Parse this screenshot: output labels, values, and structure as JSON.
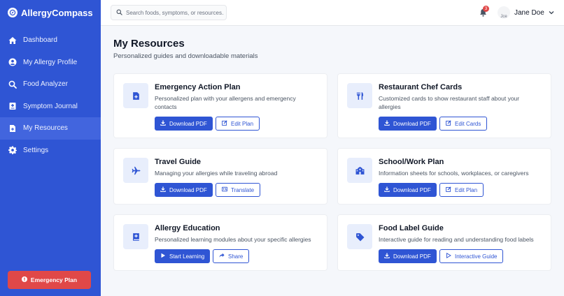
{
  "app": {
    "name": "AllergyCompass"
  },
  "sidebar": {
    "items": [
      {
        "label": "Dashboard",
        "icon": "home-icon"
      },
      {
        "label": "My Allergy Profile",
        "icon": "user-circle-icon"
      },
      {
        "label": "Food Analyzer",
        "icon": "search-icon"
      },
      {
        "label": "Symptom Journal",
        "icon": "journal-icon"
      },
      {
        "label": "My Resources",
        "icon": "file-icon",
        "active": true
      },
      {
        "label": "Settings",
        "icon": "gear-icon"
      }
    ],
    "emergency_label": "Emergency Plan"
  },
  "header": {
    "search_placeholder": "Search foods, symptoms, or resources...",
    "notification_count": "3",
    "user_name": "Jane Doe",
    "avatar_alt": "Jce"
  },
  "main": {
    "title": "My Resources",
    "subtitle": "Personalized guides and downloadable materials",
    "cards": [
      {
        "title": "Emergency Action Plan",
        "description": "Personalized plan with your allergens and emergency contacts",
        "icon": "medical-file-icon",
        "primary": "Download PDF",
        "secondary": "Edit Plan"
      },
      {
        "title": "Restaurant Chef Cards",
        "description": "Customized cards to show restaurant staff about your allergies",
        "icon": "utensils-icon",
        "primary": "Download PDF",
        "secondary": "Edit Cards"
      },
      {
        "title": "Travel Guide",
        "description": "Managing your allergies while traveling abroad",
        "icon": "plane-icon",
        "primary": "Download PDF",
        "secondary": "Translate"
      },
      {
        "title": "School/Work Plan",
        "description": "Information sheets for schools, workplaces, or caregivers",
        "icon": "school-icon",
        "primary": "Download PDF",
        "secondary": "Edit Plan"
      },
      {
        "title": "Allergy Education",
        "description": "Personalized learning modules about your specific allergies",
        "icon": "book-icon",
        "primary": "Start Learning",
        "secondary": "Share"
      },
      {
        "title": "Food Label Guide",
        "description": "Interactive guide for reading and understanding food labels",
        "icon": "tag-icon",
        "primary": "Download PDF",
        "secondary": "Interactive Guide"
      }
    ]
  },
  "colors": {
    "brand": "#2f55d4",
    "danger": "#e04848",
    "background": "#f5f7fb"
  }
}
